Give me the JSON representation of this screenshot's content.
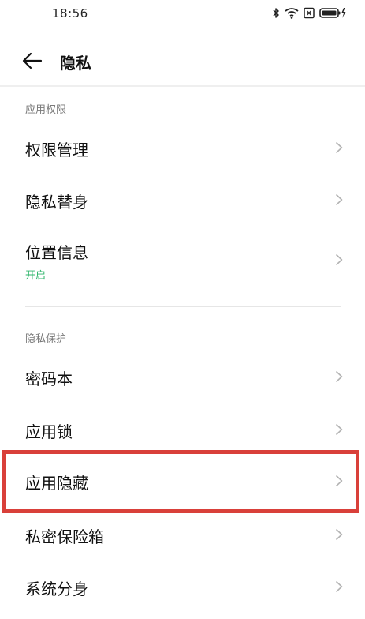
{
  "status_bar": {
    "time": "18:56",
    "icons": [
      "bluetooth-icon",
      "wifi-icon",
      "sim-card-icon",
      "battery-charging-icon"
    ]
  },
  "header": {
    "back_icon": "back-arrow-icon",
    "title": "隐私"
  },
  "sections": [
    {
      "title": "应用权限",
      "items": [
        {
          "label": "权限管理"
        },
        {
          "label": "隐私替身"
        },
        {
          "label": "位置信息",
          "sub": "开启"
        }
      ]
    },
    {
      "title": "隐私保护",
      "items": [
        {
          "label": "密码本"
        },
        {
          "label": "应用锁"
        },
        {
          "label": "应用隐藏",
          "highlighted": true
        },
        {
          "label": "私密保险箱"
        },
        {
          "label": "系统分身"
        }
      ]
    }
  ],
  "colors": {
    "highlight_border": "#d9403a",
    "sub_text_green": "#2fb66b",
    "section_header_gray": "#7a7a7a"
  }
}
